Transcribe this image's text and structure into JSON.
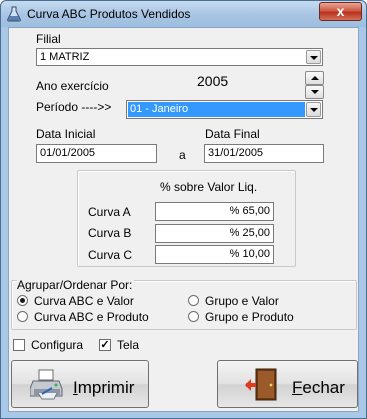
{
  "window": {
    "title": "Curva ABC Produtos Vendidos",
    "close_symbol": "x"
  },
  "filial": {
    "label": "Filial",
    "value": "1 MATRIZ"
  },
  "ano": {
    "label": "Ano exercício",
    "value": "2005"
  },
  "periodo": {
    "label": "Período ---->>",
    "value": "01 - Janeiro"
  },
  "datas": {
    "inicial_label": "Data Inicial",
    "inicial_value": "01/01/2005",
    "separator": "a",
    "final_label": "Data Final",
    "final_value": "31/01/2005"
  },
  "curvas": {
    "header": "% sobre Valor Liq.",
    "rows": [
      {
        "label": "Curva A",
        "value": "% 65,00"
      },
      {
        "label": "Curva B",
        "value": "% 25,00"
      },
      {
        "label": "Curva C",
        "value": "% 10,00"
      }
    ]
  },
  "agrupar": {
    "label": "Agrupar/Ordenar Por:",
    "options": [
      {
        "label": "Curva ABC e Valor",
        "selected": true
      },
      {
        "label": "Curva ABC e Produto",
        "selected": false
      },
      {
        "label": "Grupo e Valor",
        "selected": false
      },
      {
        "label": "Grupo e Produto",
        "selected": false
      }
    ]
  },
  "opcoes": {
    "configura_label": "Configura",
    "configura_checked": false,
    "tela_label": "Tela",
    "tela_checked": true,
    "check_mark": "✓"
  },
  "buttons": {
    "imprimir_first": "I",
    "imprimir_rest": "mprimir",
    "fechar_first": "F",
    "fechar_rest": "echar"
  },
  "icons": {
    "app": "flask-icon",
    "print": "printer-icon",
    "exit": "exit-door-icon"
  },
  "colors": {
    "title_bg": "#a9c7e6",
    "close_red": "#c8442c",
    "selection_blue": "#3399ff"
  }
}
